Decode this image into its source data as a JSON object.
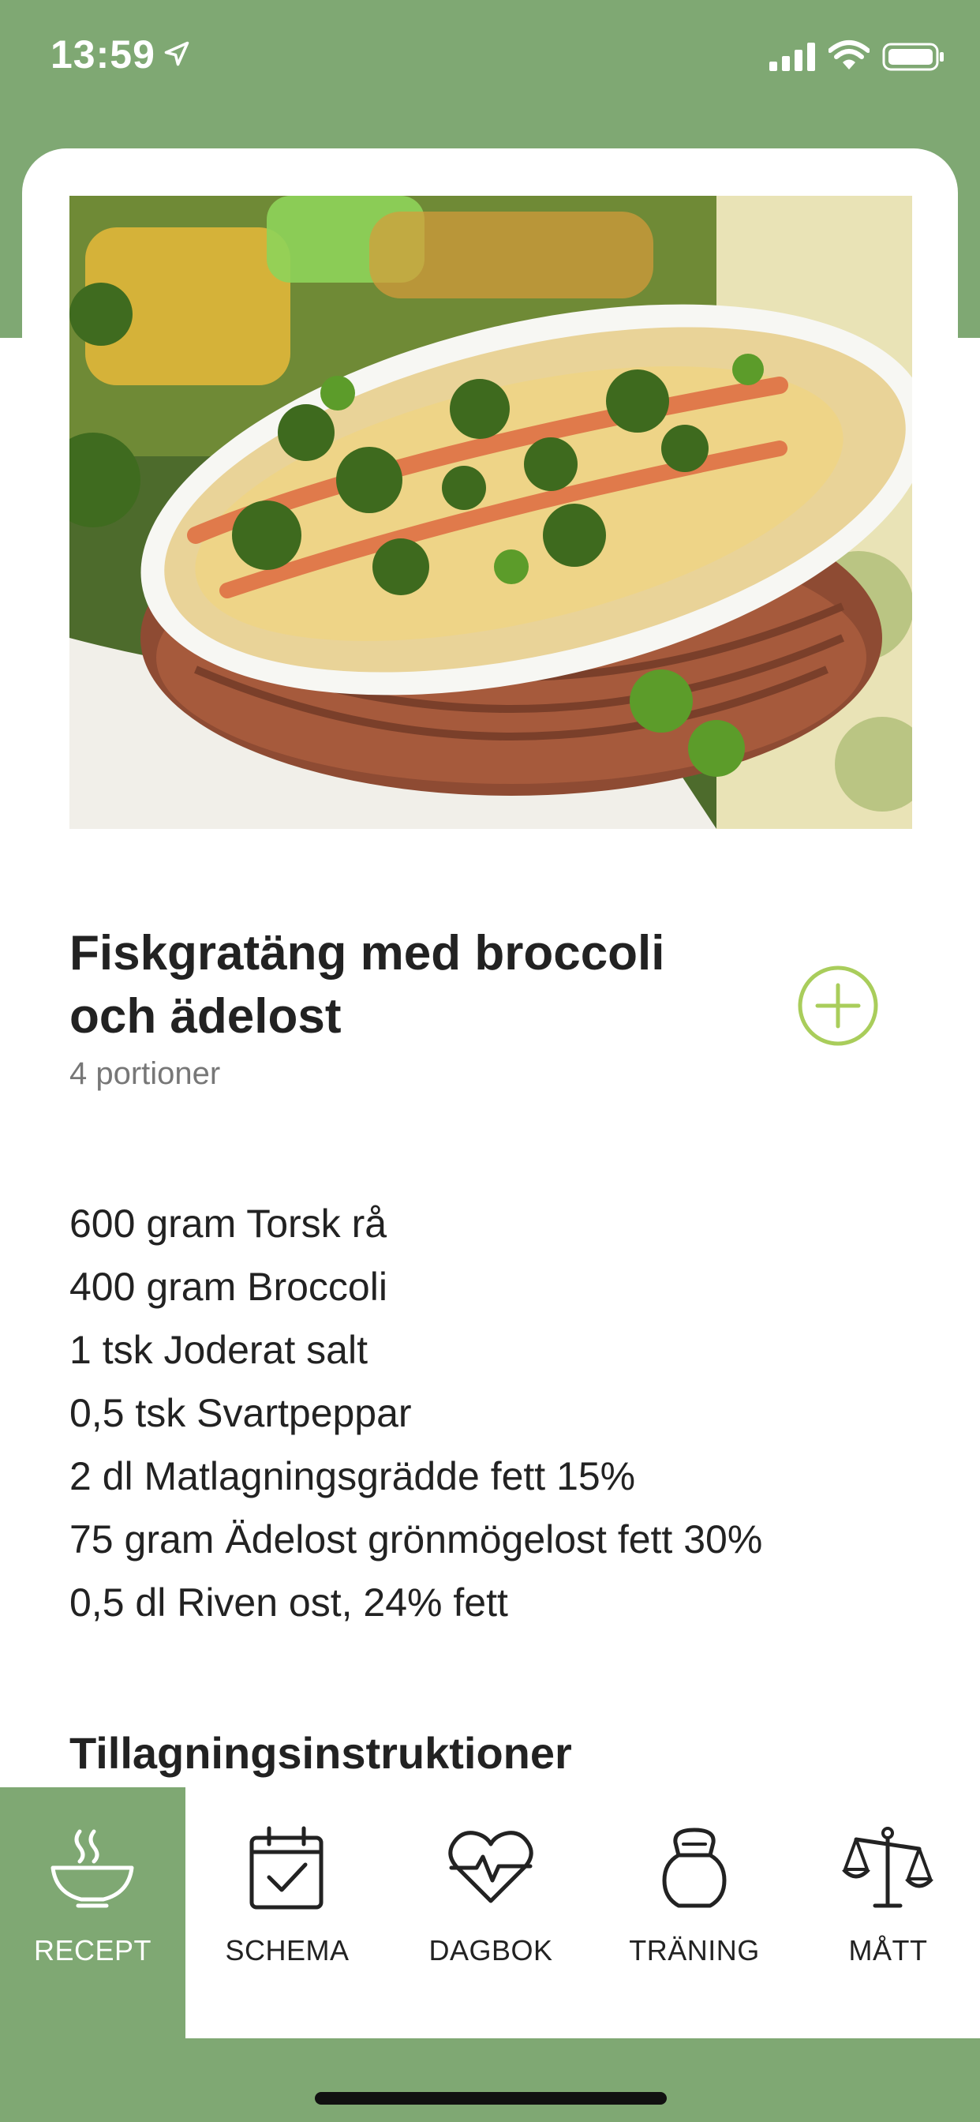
{
  "status_bar": {
    "time": "13:59",
    "icons": [
      "location-arrow-icon",
      "cellular-signal-icon",
      "wifi-icon",
      "battery-icon"
    ]
  },
  "colors": {
    "brand_green": "#7fa873",
    "accent_lime": "#a9cd5b",
    "text_dark": "#222222",
    "text_muted": "#777777"
  },
  "recipe": {
    "image_icon": "recipe-photo",
    "title": "Fiskgratäng med broccoli och ädelost",
    "portions": "4 portioner",
    "ingredients": [
      "600 gram Torsk rå",
      "400 gram Broccoli",
      "1 tsk Joderat salt",
      "0,5 tsk Svartpeppar",
      "2 dl Matlagningsgrädde fett 15%",
      "75 gram Ädelost grönmögelost fett 30%",
      "0,5 dl Riven ost, 24% fett"
    ],
    "instructions_heading": "Tillagningsinstruktioner"
  },
  "tabbar": {
    "tabs": [
      {
        "label": "RECEPT",
        "icon": "bowl-icon",
        "active": true
      },
      {
        "label": "SCHEMA",
        "icon": "calendar-check-icon",
        "active": false
      },
      {
        "label": "DAGBOK",
        "icon": "heart-pulse-icon",
        "active": false
      },
      {
        "label": "TRÄNING",
        "icon": "kettlebell-icon",
        "active": false
      },
      {
        "label": "MÅTT",
        "icon": "scale-icon",
        "active": false
      }
    ]
  }
}
